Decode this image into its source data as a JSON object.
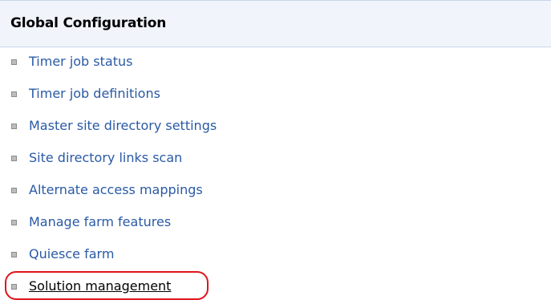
{
  "section": {
    "title": "Global Configuration"
  },
  "links": [
    {
      "label": "Timer job status"
    },
    {
      "label": "Timer job definitions"
    },
    {
      "label": "Master site directory settings"
    },
    {
      "label": "Site directory links scan"
    },
    {
      "label": "Alternate access mappings"
    },
    {
      "label": "Manage farm features"
    },
    {
      "label": "Quiesce farm"
    },
    {
      "label": "Solution management"
    }
  ],
  "colors": {
    "link": "#2a5aa5",
    "header_background": "#f1f5fb",
    "highlight_ring": "#e0141c"
  },
  "icons": {
    "bullet": "square-bullet-icon"
  }
}
